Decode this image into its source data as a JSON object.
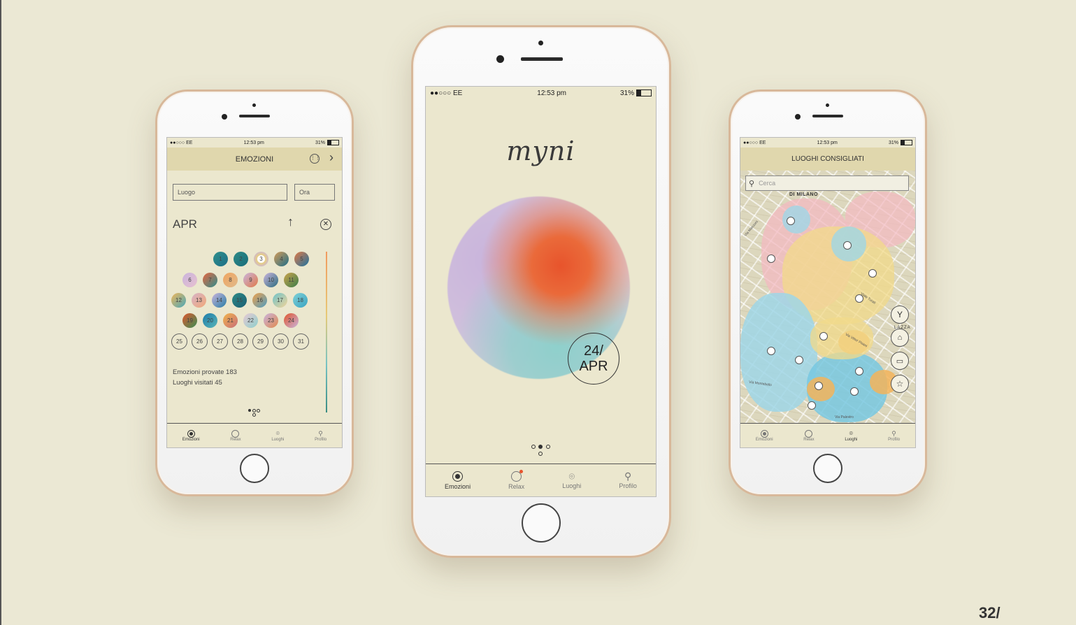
{
  "page_number": "32/",
  "status": {
    "carrier": "●●○○○ EE",
    "carrier_big": "●●○○○ EE",
    "time": "12:53 pm",
    "battery": "31%",
    "battery_level": 0.31
  },
  "left": {
    "header_title": "EMOZIONI",
    "place_placeholder": "Luogo",
    "time_placeholder": "Ora",
    "month": "APR",
    "days": [
      "1",
      "2",
      "3",
      "4",
      "5",
      "6",
      "7",
      "8",
      "9",
      "10",
      "11",
      "12",
      "13",
      "14",
      "15",
      "16",
      "17",
      "18",
      "19",
      "20",
      "21",
      "22",
      "23",
      "24",
      "25",
      "26",
      "27",
      "28",
      "29",
      "30",
      "31"
    ],
    "stats_emotions": "Emozioni provate 183",
    "stats_places": "Luoghi visitati 45"
  },
  "center": {
    "logo": "myni",
    "date_day": "24/",
    "date_month": "APR"
  },
  "right": {
    "header_title": "LUOGHI CONSIGLIATI",
    "search_placeholder": "Cerca",
    "map_labels": {
      "district": "DI MILANO",
      "piazza": "LAZZA",
      "street1": "Via Montebello",
      "street2": "Via Palestro",
      "street3": "Viale Turati",
      "street4": "Via Vittor Pisani",
      "street5": "Via Manzoni"
    }
  },
  "tabs": [
    {
      "label": "Emozioni",
      "icon": "emotion-dot-icon"
    },
    {
      "label": "Relax",
      "icon": "relax-target-icon"
    },
    {
      "label": "Luoghi",
      "icon": "location-pin-icon"
    },
    {
      "label": "Profilo",
      "icon": "profile-person-icon"
    }
  ],
  "colors": {
    "background": "#ebe8d4",
    "screen": "#ebe7ce",
    "frame_gold": "#d8b89a",
    "orb_red": "#e8542c",
    "orb_lilac": "#c9b4dc",
    "orb_teal": "#8fd0cc",
    "map_pink": "#f3b9c2",
    "map_yellow": "#f1d98a",
    "map_blue": "#9fd6e6",
    "map_orange": "#f3b45a"
  }
}
